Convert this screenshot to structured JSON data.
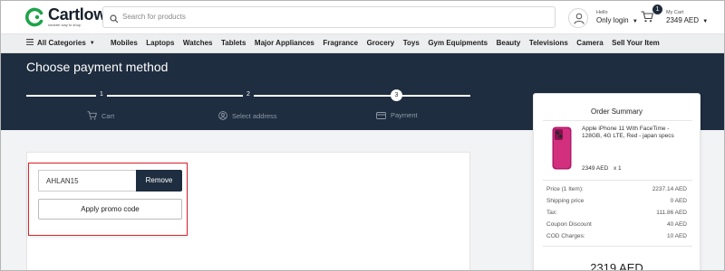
{
  "header": {
    "brand_name": "Cartlow",
    "brand_tagline": "smarter way to shop",
    "search_placeholder": "Search for products",
    "account_greeting": "Hello",
    "account_action": "Only login",
    "cart_badge": "1",
    "cart_label": "My Cart",
    "cart_amount": "2349 AED"
  },
  "nav": {
    "all_categories": "All Categories",
    "items": [
      "Mobiles",
      "Laptops",
      "Watches",
      "Tablets",
      "Major Appliances",
      "Fragrance",
      "Grocery",
      "Toys",
      "Gym Equipments",
      "Beauty",
      "Televisions",
      "Camera",
      "Sell Your Item"
    ]
  },
  "checkout": {
    "title": "Choose payment method",
    "steps": [
      {
        "num": "1",
        "label": "Cart",
        "icon": "cart-icon"
      },
      {
        "num": "2",
        "label": "Select address",
        "icon": "user-icon"
      },
      {
        "num": "3",
        "label": "Payment",
        "icon": "card-icon"
      }
    ],
    "current_step": 3
  },
  "promo": {
    "code_value": "AHLAN15",
    "remove_label": "Remove",
    "apply_label": "Apply promo code"
  },
  "summary": {
    "title": "Order Summary",
    "product_name": "Apple iPhone 11 With FaceTime - 128GB, 4G LTE, Red - japan specs",
    "product_price": "2349 AED",
    "product_qty": "x 1",
    "rows": [
      {
        "label": "Price (1 Item):",
        "value": "2237.14 AED"
      },
      {
        "label": "Shipping price",
        "value": "0 AED"
      },
      {
        "label": "Tax:",
        "value": "111.86 AED"
      },
      {
        "label": "Coupon Discount",
        "value": "40 AED"
      },
      {
        "label": "COD Charges:",
        "value": "10 AED"
      }
    ],
    "total": "2319 AED"
  },
  "colors": {
    "brand_green": "#1fa34a",
    "navy": "#1e2d3f",
    "highlight_red": "#d9232a"
  }
}
